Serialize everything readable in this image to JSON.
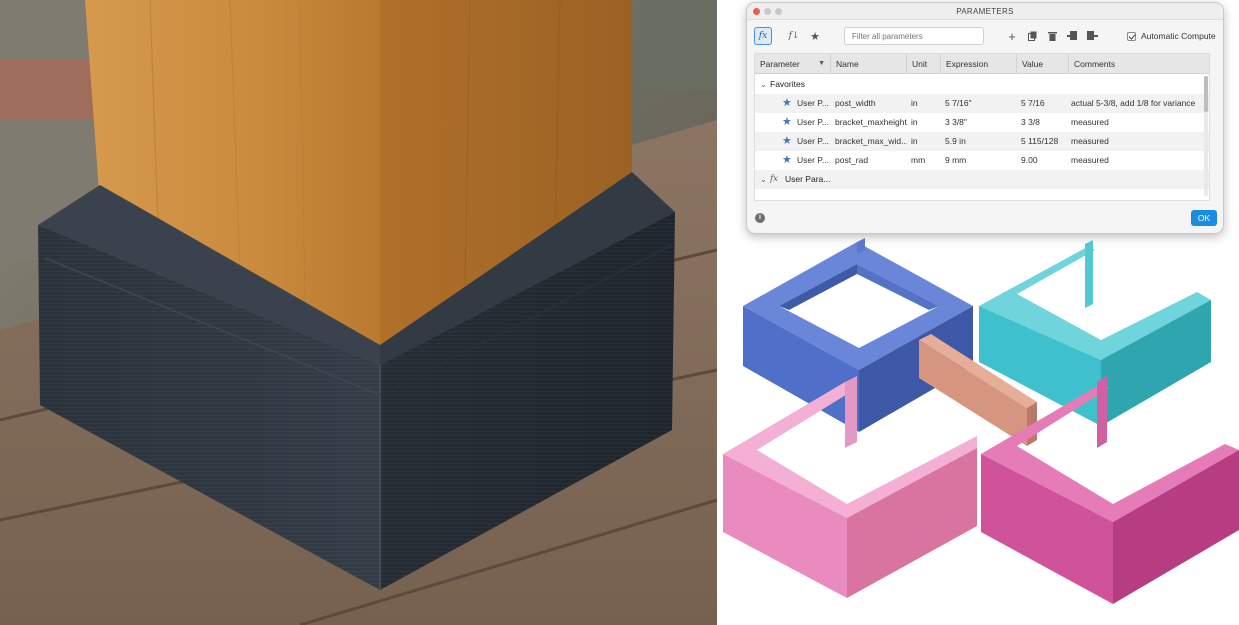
{
  "dialog": {
    "title": "PARAMETERS",
    "filter_placeholder": "Filter all parameters",
    "auto_compute_label": "Automatic Compute",
    "ok_label": "OK"
  },
  "table": {
    "columns": [
      "Parameter",
      "Name",
      "Unit",
      "Expression",
      "Value",
      "Comments"
    ],
    "groups": {
      "favorites": "Favorites",
      "user": "User Para..."
    },
    "rows": [
      {
        "param": "User P...",
        "name": "post_width",
        "unit": "in",
        "expression": "5 7/16\"",
        "value": "5 7/16",
        "comment": "actual 5-3/8, add 1/8 for variance"
      },
      {
        "param": "User P...",
        "name": "bracket_maxheight",
        "unit": "in",
        "expression": "3 3/8\"",
        "value": "3 3/8",
        "comment": "measured"
      },
      {
        "param": "User P...",
        "name": "bracket_max_wid...",
        "unit": "in",
        "expression": "5.9 in",
        "value": "5 115/128",
        "comment": "measured"
      },
      {
        "param": "User P...",
        "name": "post_rad",
        "unit": "mm",
        "expression": "9 mm",
        "value": "9.00",
        "comment": "measured"
      }
    ]
  },
  "colors": {
    "blue_part": "#4f6fc8",
    "teal_part": "#3ec1cc",
    "salmon_part": "#d6957f",
    "pink_part": "#e98bbf",
    "magenta_part": "#d0529a",
    "bracket": "#2c343d",
    "wood": "#c98a3c",
    "accent": "#1a8de0"
  }
}
